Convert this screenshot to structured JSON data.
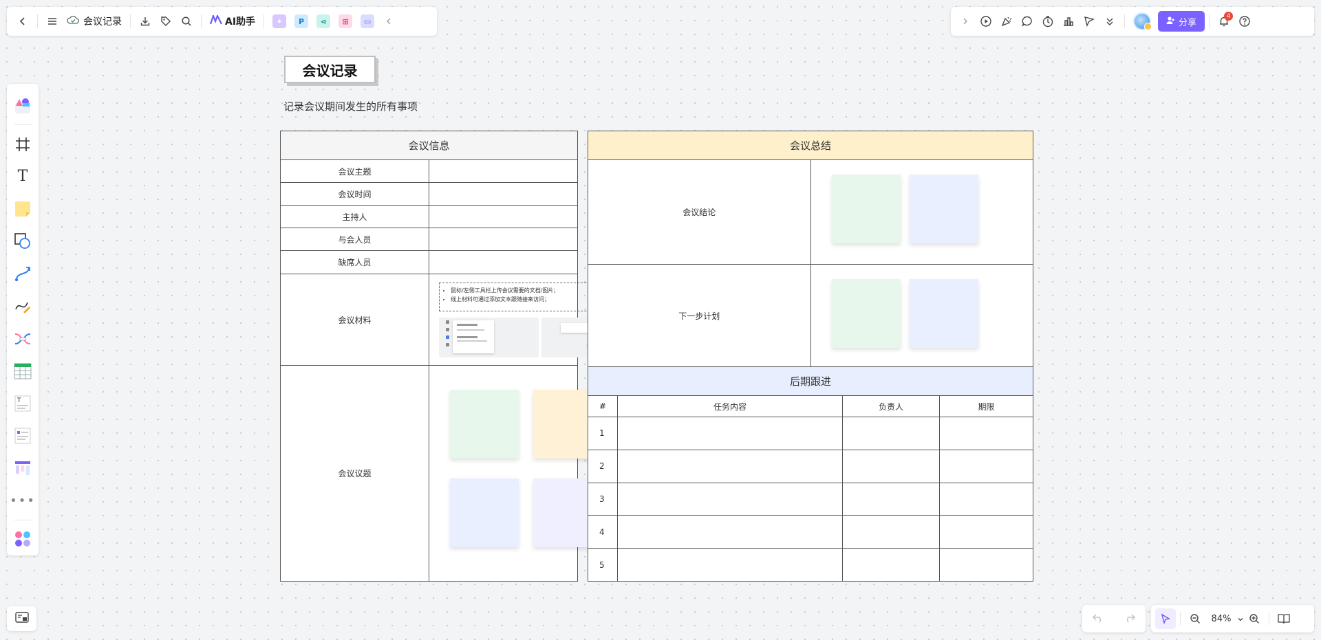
{
  "toolbar": {
    "doc_title": "会议记录",
    "ai_label": "AI助手",
    "share_label": "分享",
    "notification_count": "4",
    "zoom_level": "84%"
  },
  "page": {
    "title": "会议记录",
    "subtitle": "记录会议期间发生的所有事项"
  },
  "meeting_info": {
    "header": "会议信息",
    "rows": [
      "会议主题",
      "会议时间",
      "主持人",
      "与会人员",
      "缺席人员",
      "会议材料",
      "会议议题"
    ],
    "materials_notes": [
      "鼠标/左侧工具栏上传会议需要的文档/图片；",
      "线上材料可通过添加文本跟随接来访问；"
    ],
    "topic_sticky_colors": [
      "#e7f7ec",
      "#fff1d6",
      "#e9efff",
      "#efefff"
    ]
  },
  "summary": {
    "header": "会议总结",
    "rows": [
      "会议结论",
      "下一步计划"
    ],
    "sticky_colors": [
      "#e7f7ec",
      "#e9efff"
    ]
  },
  "follow_up": {
    "header": "后期跟进",
    "columns": [
      "#",
      "任务内容",
      "负责人",
      "期限"
    ],
    "rows": [
      "1",
      "2",
      "3",
      "4",
      "5"
    ]
  },
  "icons": {
    "left_bar": [
      "template-icon",
      "frame-icon",
      "text-icon",
      "sticky-note-icon",
      "shape-icon",
      "connector-icon",
      "pen-icon",
      "mindmap-icon",
      "table-icon",
      "text-card-icon",
      "list-card-icon",
      "kanban-icon",
      "more-icon",
      "apps-icon"
    ]
  },
  "colors": {
    "accent": "#7b61ff",
    "badge": "#f04438"
  }
}
